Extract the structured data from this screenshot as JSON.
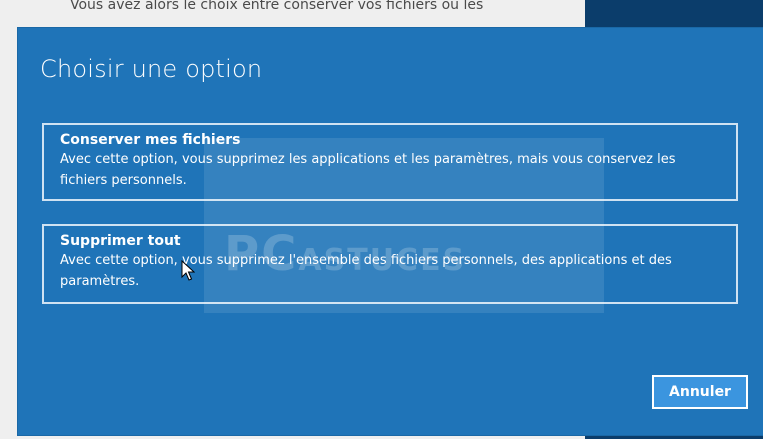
{
  "background": {
    "text": "Vous avez alors le choix entre conserver vos fichiers ou les"
  },
  "dialog": {
    "title": "Choisir une option",
    "options": [
      {
        "title": "Conserver mes fichiers",
        "description": "Avec cette option, vous supprimez les applications et les paramètres, mais vous conservez les fichiers personnels."
      },
      {
        "title": "Supprimer tout",
        "description": "Avec cette option, vous supprimez l'ensemble des fichiers personnels, des applications et des paramètres."
      }
    ],
    "cancel_label": "Annuler"
  },
  "watermark": {
    "big": "PC",
    "small": "ASTUCES"
  },
  "colors": {
    "dialog_bg": "#1f74b8",
    "button_bg": "#3b95df",
    "outline": "#cfe2f2"
  }
}
